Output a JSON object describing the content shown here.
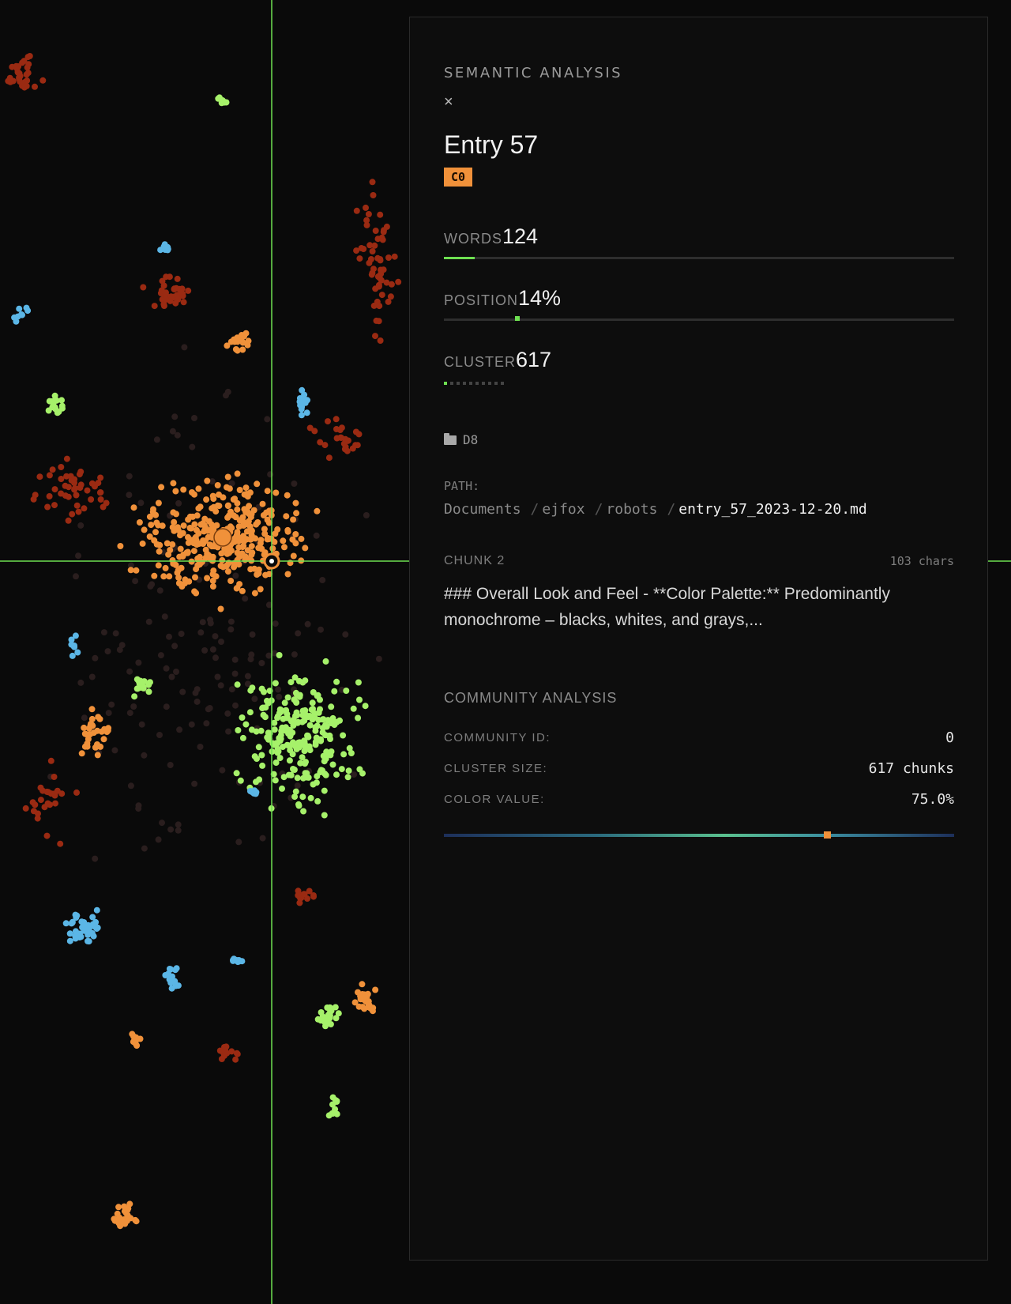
{
  "panel": {
    "section_title": "SEMANTIC ANALYSIS",
    "close_icon": "×",
    "entry_title": "Entry 57",
    "cluster_badge": "C0",
    "metrics": {
      "words": {
        "label": "WORDS",
        "value": "124",
        "fraction": 0.06
      },
      "position": {
        "label": "POSITION",
        "value": "14%",
        "fraction": 0.14
      },
      "cluster": {
        "label": "CLUSTER",
        "value": "617",
        "active_dots": 1,
        "total_dots": 10
      }
    },
    "folder": {
      "icon": "folder-icon",
      "name": "D8"
    },
    "path": {
      "label": "PATH:",
      "segments": [
        "Documents",
        "ejfox",
        "robots"
      ],
      "separator": "/",
      "file": "entry_57_2023-12-20.md"
    },
    "chunk": {
      "label": "CHUNK 2",
      "chars": "103 chars",
      "text": "### Overall Look and Feel - **Color Palette:** Predominantly monochrome – blacks, whites, and grays,..."
    },
    "community": {
      "title": "COMMUNITY ANALYSIS",
      "id_label": "COMMUNITY ID:",
      "id_value": "0",
      "size_label": "CLUSTER SIZE:",
      "size_value": "617 chunks",
      "color_label": "COLOR VALUE:",
      "color_value": "75.0%",
      "color_fraction": 0.75
    }
  },
  "colors": {
    "accent_green": "#6ee051",
    "badge_orange": "#f0913a",
    "point_orange": "#f0913a",
    "point_green": "#a6f16a",
    "point_blue": "#5bb6e6",
    "point_red": "#9a2a12",
    "point_dim": "#2a1e1e"
  }
}
